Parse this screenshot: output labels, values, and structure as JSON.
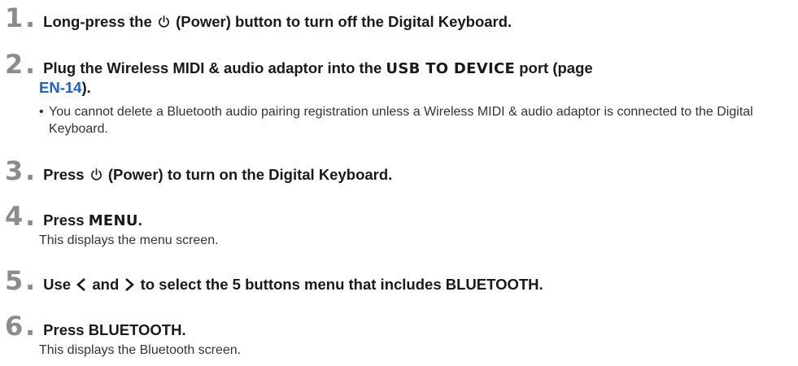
{
  "steps": [
    {
      "number": "1",
      "pre": "Long-press the",
      "post": "(Power) button to turn off the Digital Keyboard."
    },
    {
      "number": "2",
      "pre": "Plug the Wireless MIDI & audio adaptor into the",
      "keyword": "USB TO DEVICE",
      "mid": "port (page",
      "link": "EN-14",
      "end": ").",
      "bullet": "You cannot delete a Bluetooth audio pairing registration unless a Wireless MIDI & audio adaptor is connected to the Digital Keyboard."
    },
    {
      "number": "3",
      "pre": "Press",
      "post": "(Power) to turn on the Digital Keyboard."
    },
    {
      "number": "4",
      "pre": "Press",
      "keyword": "MENU",
      "end": ".",
      "note": "This displays the menu screen."
    },
    {
      "number": "5",
      "pre": "Use",
      "mid": "and",
      "post": "to select the 5 buttons menu that includes BLUETOOTH."
    },
    {
      "number": "6",
      "title": "Press BLUETOOTH.",
      "note": "This displays the Bluetooth screen."
    }
  ],
  "icons": {
    "power": "power-icon",
    "left": "left-chevron-icon",
    "right": "right-chevron-icon"
  },
  "colors": {
    "step_number": "#8c8c8c",
    "link": "#1a5fd6"
  }
}
